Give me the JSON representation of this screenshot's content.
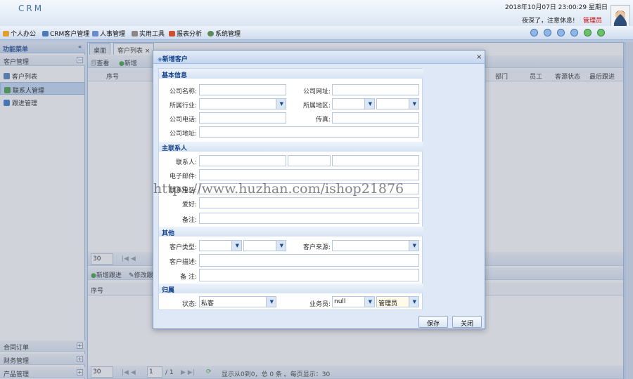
{
  "header": {
    "logo": "CRM",
    "datetime": "2018年10月07日 23:00:29 星期日",
    "greeting": "夜深了，注意休息!",
    "role": "管理员"
  },
  "menu": [
    "个人办公",
    "CRM客户管理",
    "人事管理",
    "实用工具",
    "报表分析",
    "系统管理"
  ],
  "sidebar": {
    "title": "功能菜单",
    "group": "客户管理",
    "items": [
      "客户列表",
      "联系人管理",
      "跟进管理"
    ],
    "bottom": [
      "合同订单",
      "财务管理",
      "产品管理"
    ]
  },
  "tabs": [
    "桌面",
    "客户列表"
  ],
  "toolbar": {
    "view": "查看",
    "add": "新增"
  },
  "grid_top": {
    "cols_left": [
      "序号"
    ],
    "cols_right": [
      "部门",
      "员工",
      "客源状态",
      "最后跟进"
    ],
    "page_size": "30"
  },
  "grid_bottom": {
    "add_follow": "新增跟进",
    "edit_follow": "修改跟",
    "cols": [
      "序号"
    ]
  },
  "pager": {
    "page_size": "30",
    "page": "1",
    "total": "/ 1",
    "info": "显示从0到0，总 0 条 。每页显示：30"
  },
  "dialog": {
    "title": "新增客户",
    "sections": {
      "basic": "基本信息",
      "contact": "主联系人",
      "other": "其他",
      "owner": "归属"
    },
    "labels": {
      "company_name": "公司名称:",
      "website": "公司网址:",
      "industry": "所属行业:",
      "region": "所属地区:",
      "phone": "公司电话:",
      "fax": "传真:",
      "address": "公司地址:",
      "contact_person": "联系人:",
      "email": "电子邮件:",
      "mobile": "联系电话:",
      "hobby": "爱好:",
      "remark": "备注:",
      "cust_type": "客户类型:",
      "cust_source": "客户来源:",
      "cust_desc": "客户描述:",
      "remark2": "备 注:",
      "status": "状态:",
      "salesman": "业务员:"
    },
    "values": {
      "status": "私客",
      "salesman": "null",
      "manager": "管理员"
    },
    "buttons": {
      "save": "保存",
      "close": "关闭"
    }
  },
  "watermark": "https://www.huzhan.com/ishop21876"
}
